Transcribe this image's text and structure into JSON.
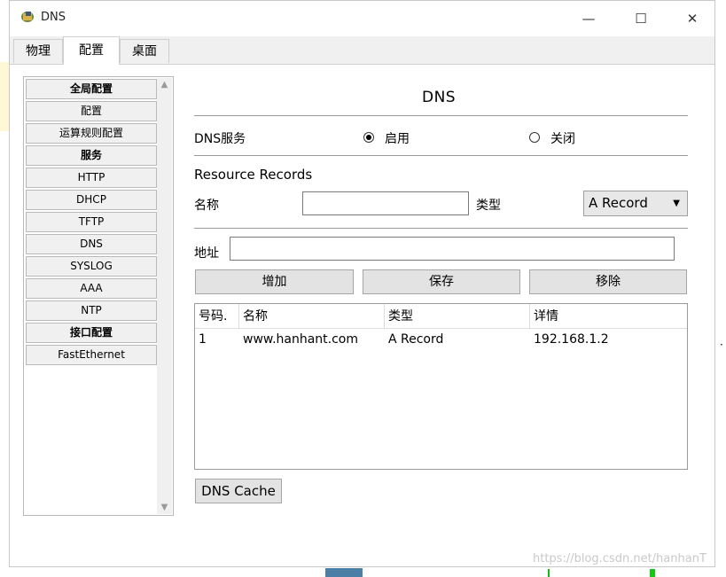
{
  "window": {
    "title": "DNS",
    "controls": {
      "minimize": "—",
      "maximize": "☐",
      "close": "✕"
    }
  },
  "tabs": [
    {
      "label": "物理"
    },
    {
      "label": "配置"
    },
    {
      "label": "桌面"
    }
  ],
  "sidebar": {
    "items": [
      {
        "label": "全局配置",
        "header": true
      },
      {
        "label": "配置",
        "header": false
      },
      {
        "label": "运算规则配置",
        "header": false
      },
      {
        "label": "服务",
        "header": true
      },
      {
        "label": "HTTP",
        "header": false
      },
      {
        "label": "DHCP",
        "header": false
      },
      {
        "label": "TFTP",
        "header": false
      },
      {
        "label": "DNS",
        "header": false
      },
      {
        "label": "SYSLOG",
        "header": false
      },
      {
        "label": "AAA",
        "header": false
      },
      {
        "label": "NTP",
        "header": false
      },
      {
        "label": "接口配置",
        "header": true
      },
      {
        "label": "FastEthernet",
        "header": false
      }
    ]
  },
  "dns": {
    "heading": "DNS",
    "service_label": "DNS服务",
    "on_label": "启用",
    "off_label": "关闭",
    "service_state": "on",
    "records_label": "Resource Records",
    "name_label": "名称",
    "name_value": "",
    "type_label": "类型",
    "type_value": "A Record",
    "address_label": "地址",
    "address_value": "",
    "add_button": "增加",
    "save_button": "保存",
    "remove_button": "移除",
    "cache_button": "DNS Cache"
  },
  "table": {
    "columns": [
      "号码.",
      "名称",
      "类型",
      "详情"
    ],
    "rows": [
      [
        "1",
        "www.hanhant.com",
        "A Record",
        "192.168.1.2"
      ]
    ]
  },
  "watermark": "https://blog.csdn.net/hanhanT",
  "background": {
    "dots": "·"
  },
  "colors": {
    "accent_blue": "#4b7fa6",
    "accent_green": "#14c814"
  }
}
